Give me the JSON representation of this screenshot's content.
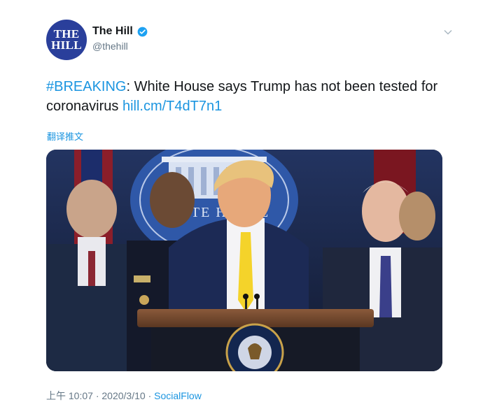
{
  "account": {
    "avatar_line1": "THE",
    "avatar_line2": "HILL",
    "name": "The Hill",
    "handle": "@thehill",
    "verified_icon": "verified-badge-icon",
    "verified_color": "#1da1f2"
  },
  "tweet": {
    "hashtag": "#BREAKING",
    "text_part1": ": White House says Trump has not been tested for",
    "text_part2": "coronavirus",
    "link": "hill.cm/T4dT7n1",
    "translate_label": "翻译推文"
  },
  "media": {
    "backdrop_text": "WHITE HOUSE",
    "seal_text": "PRESIDENT OF THE UNITED STATES"
  },
  "meta": {
    "time": "上午 10:07",
    "separator": "·",
    "date": "2020/3/10",
    "source": "SocialFlow"
  },
  "colors": {
    "link": "#1b95e0",
    "brand": "#2a3f9b",
    "text": "#14171a",
    "muted": "#657786"
  }
}
